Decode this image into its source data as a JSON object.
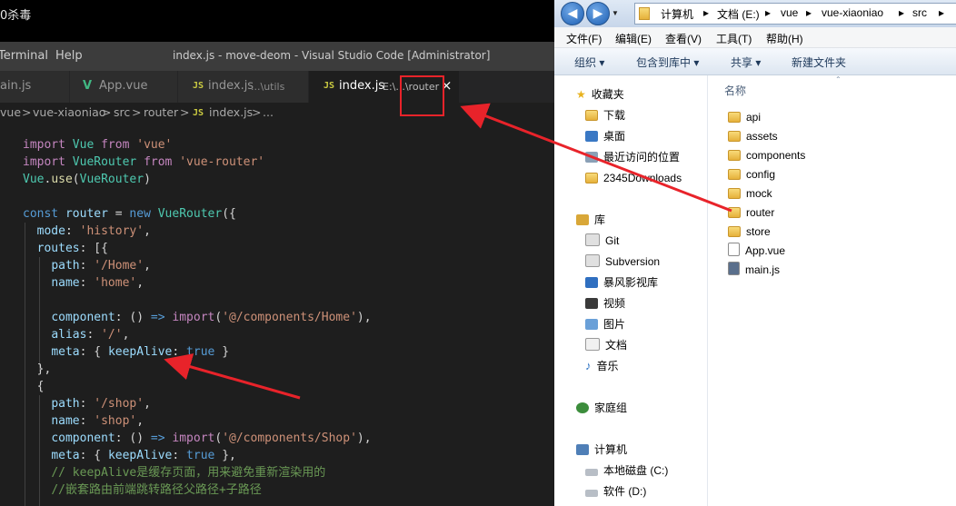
{
  "top_strip": {
    "text": "0杀毒"
  },
  "vscode": {
    "menu": [
      "Terminal",
      "Help"
    ],
    "window_title": "index.js - move-deom - Visual Studio Code [Administrator]",
    "tabs": [
      {
        "icon": "",
        "label": "ain.js",
        "hint": ""
      },
      {
        "icon": "V",
        "label": "App.vue",
        "hint": ""
      },
      {
        "icon": "JS",
        "label": "index.js",
        "hint": "...\\utils"
      },
      {
        "icon": "JS",
        "label": "index.js",
        "hint": "E:\\...\\router",
        "close": "×"
      }
    ],
    "breadcrumb": [
      "vue",
      ">",
      "vue-xiaoniao",
      ">",
      "src",
      ">",
      "router",
      ">",
      "JS",
      "index.js",
      ">",
      "..."
    ]
  },
  "code_lines": [
    "import Vue from 'vue'",
    "import VueRouter from 'vue-router'",
    "Vue.use(VueRouter)",
    "",
    "const router = new VueRouter({",
    "  mode: 'history',",
    "  routes: [{",
    "    path: '/Home',",
    "    name: 'home',",
    "",
    "    component: () => import('@/components/Home'),",
    "    alias: '/',",
    "    meta: { keepAlive: true }",
    "  },",
    "  {",
    "    path: '/shop',",
    "    name: 'shop',",
    "    component: () => import('@/components/Shop'),",
    "    meta: { keepAlive: true },",
    "    // keepAlive是缓存页面，用来避免重新渲染用的",
    "    //嵌套路由前端跳转路径父路径+子路径"
  ],
  "explorer": {
    "address": [
      "计算机",
      "▸",
      "文档 (E:)",
      "▸",
      "vue",
      "▸",
      "vue-xiaoniao",
      "▸",
      "src",
      "▸"
    ],
    "menu": [
      "文件(F)",
      "编辑(E)",
      "查看(V)",
      "工具(T)",
      "帮助(H)"
    ],
    "toolbar": [
      "组织 ▾",
      "包含到库中 ▾",
      "共享 ▾",
      "新建文件夹"
    ],
    "nav": {
      "favorites": "收藏夹",
      "favorites_items": [
        "下载",
        "桌面",
        "最近访问的位置",
        "2345Downloads"
      ],
      "libraries": "库",
      "library_items": [
        "Git",
        "Subversion",
        "暴风影视库",
        "视频",
        "图片",
        "文档",
        "音乐"
      ],
      "homegroup": "家庭组",
      "computer": "计算机",
      "drives": [
        "本地磁盘 (C:)",
        "软件 (D:)"
      ]
    },
    "column_header": "名称",
    "files": [
      {
        "name": "api",
        "type": "folder"
      },
      {
        "name": "assets",
        "type": "folder"
      },
      {
        "name": "components",
        "type": "folder"
      },
      {
        "name": "config",
        "type": "folder"
      },
      {
        "name": "mock",
        "type": "folder"
      },
      {
        "name": "router",
        "type": "folder"
      },
      {
        "name": "store",
        "type": "folder"
      },
      {
        "name": "App.vue",
        "type": "file"
      },
      {
        "name": "main.js",
        "type": "file"
      }
    ]
  },
  "colors": {
    "annotation_red": "#e8232a",
    "vscode_bg": "#1e1e1e",
    "vue_green": "#41b883",
    "js_yellow": "#cbcb41"
  }
}
